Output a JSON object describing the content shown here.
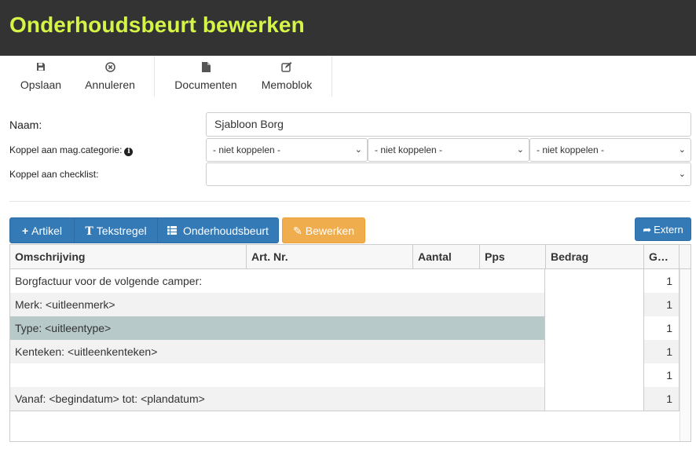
{
  "page": {
    "title": "Onderhoudsbeurt bewerken"
  },
  "toolbar": {
    "opslaan": "Opslaan",
    "annuleren": "Annuleren",
    "documenten": "Documenten",
    "memoblok": "Memoblok"
  },
  "form": {
    "naam_label": "Naam:",
    "naam_value": "Sjabloon Borg",
    "koppel_mag_label": "Koppel aan mag.categorie:",
    "koppel_mag_selects": [
      "- niet koppelen -",
      "- niet koppelen -",
      "- niet koppelen -"
    ],
    "koppel_checklist_label": "Koppel aan checklist:",
    "koppel_checklist_value": ""
  },
  "actions": {
    "artikel": "Artikel",
    "tekstregel": "Tekstregel",
    "onderhoudsbeurt": "Onderhoudsbeurt",
    "bewerken": "Bewerken",
    "extern": "Extern"
  },
  "table": {
    "headers": [
      "Omschrijving",
      "Art. Nr.",
      "Aantal",
      "Pps",
      "Bedrag",
      "G…"
    ],
    "rows": [
      {
        "omschrijving": "Borgfactuur voor de volgende camper:",
        "g": "1"
      },
      {
        "omschrijving": "Merk: <uitleenmerk>",
        "g": "1"
      },
      {
        "omschrijving": "Type: <uitleentype>",
        "g": "1"
      },
      {
        "omschrijving": "Kenteken: <uitleenkenteken>",
        "g": "1"
      },
      {
        "omschrijving": "",
        "g": "1"
      },
      {
        "omschrijving": "Vanaf: <begindatum> tot: <plandatum>",
        "g": "1"
      }
    ],
    "selected_row": 2
  },
  "colors": {
    "title": "#d4f547",
    "header_bg": "#333333",
    "primary": "#337ab7",
    "warning": "#f0ad4e",
    "selected": "#b8c9c9"
  }
}
